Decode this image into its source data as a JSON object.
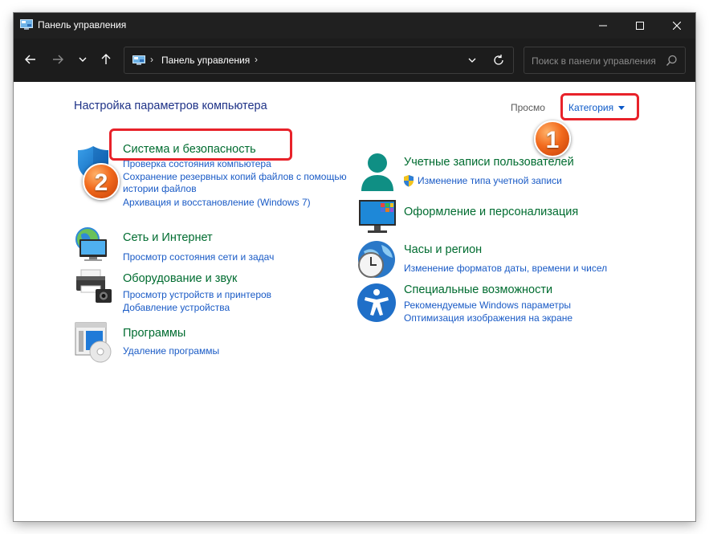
{
  "window": {
    "title": "Панель управления"
  },
  "navigation": {
    "breadcrumb_label": "Панель управления",
    "search_placeholder": "Поиск в панели управления"
  },
  "content": {
    "heading": "Настройка параметров компьютера",
    "view_by_label": "Просмо",
    "view_by_value": "Категория",
    "annotations": [
      "1",
      "2"
    ],
    "categories_left": [
      {
        "title": "Система и безопасность",
        "links": [
          "Проверка состояния компьютера",
          "Сохранение резервных копий файлов с помощью",
          "истории файлов",
          "Архивация и восстановление (Windows 7)"
        ]
      },
      {
        "title": "Сеть и Интернет",
        "links": [
          "Просмотр состояния сети и задач"
        ]
      },
      {
        "title": "Оборудование и звук",
        "links": [
          "Просмотр устройств и принтеров",
          "Добавление устройства"
        ]
      },
      {
        "title": "Программы",
        "links": [
          "Удаление программы"
        ]
      }
    ],
    "categories_right": [
      {
        "title": "Учетные записи пользователей",
        "links": [
          "Изменение типа учетной записи"
        ]
      },
      {
        "title": "Оформление и персонализация",
        "links": []
      },
      {
        "title": "Часы и регион",
        "links": [
          "Изменение форматов даты, времени и чисел"
        ]
      },
      {
        "title": "Специальные возможности",
        "links": [
          "Рекомендуемые Windows параметры",
          "Оптимизация изображения на экране"
        ]
      }
    ]
  },
  "colors": {
    "titlebar": "#202020",
    "heading": "#1e3287",
    "category_title": "#006c30",
    "link": "#1a5bc6",
    "highlight": "#e8222a",
    "badge": "#f26a1d"
  },
  "icons": [
    "control-panel-icon",
    "minimize-icon",
    "maximize-icon",
    "close-icon",
    "back-arrow-icon",
    "forward-arrow-icon",
    "recent-chevron-icon",
    "up-arrow-icon",
    "dropdown-chevron-icon",
    "refresh-icon",
    "search-icon",
    "shield-icon",
    "network-icon",
    "printer-icon",
    "programs-icon",
    "user-icon",
    "uac-shield-icon",
    "personalization-icon",
    "clock-globe-icon",
    "accessibility-icon"
  ]
}
